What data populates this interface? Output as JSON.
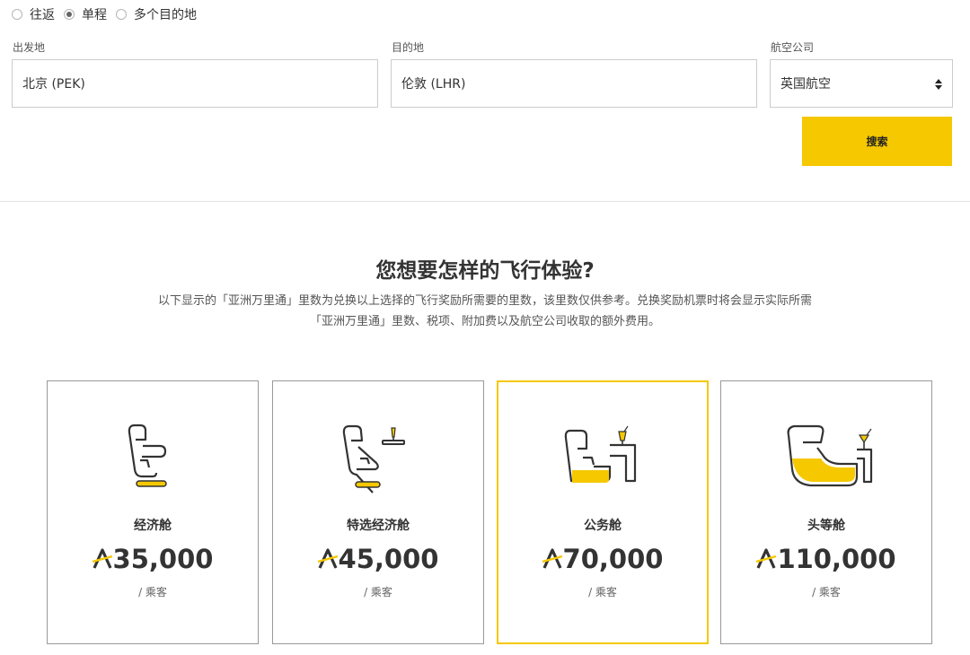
{
  "trip_type": {
    "options": [
      {
        "label": "往返",
        "checked": false
      },
      {
        "label": "单程",
        "checked": true
      },
      {
        "label": "多个目的地",
        "checked": false
      }
    ]
  },
  "search_form": {
    "origin": {
      "label": "出发地",
      "value": "北京 (PEK)"
    },
    "destination": {
      "label": "目的地",
      "value": "伦敦 (LHR)"
    },
    "airline": {
      "label": "航空公司",
      "value": "英国航空"
    },
    "search_label": "搜索"
  },
  "intro": {
    "heading": "您想要怎样的飞行体验?",
    "line1": "以下显示的「亚洲万里通」里数为兑换以上选择的飞行奖励所需要的里数，该里数仅供参考。兑换奖励机票时将会显示实际所需",
    "line2": "「亚洲万里通」里数、税项、附加费以及航空公司收取的额外费用。"
  },
  "cabins": [
    {
      "name": "经济舱",
      "price": "35,000",
      "per": "/ 乘客",
      "selected": false,
      "icon": "economy-seat-icon"
    },
    {
      "name": "特选经济舱",
      "price": "45,000",
      "per": "/ 乘客",
      "selected": false,
      "icon": "premium-economy-seat-icon"
    },
    {
      "name": "公务舱",
      "price": "70,000",
      "per": "/ 乘客",
      "selected": true,
      "icon": "business-seat-icon"
    },
    {
      "name": "头等舱",
      "price": "110,000",
      "per": "/ 乘客",
      "selected": false,
      "icon": "first-class-seat-icon"
    }
  ],
  "colors": {
    "accent": "#f5c800",
    "text": "#333333",
    "border": "#cccccc",
    "card_border": "#999999"
  }
}
